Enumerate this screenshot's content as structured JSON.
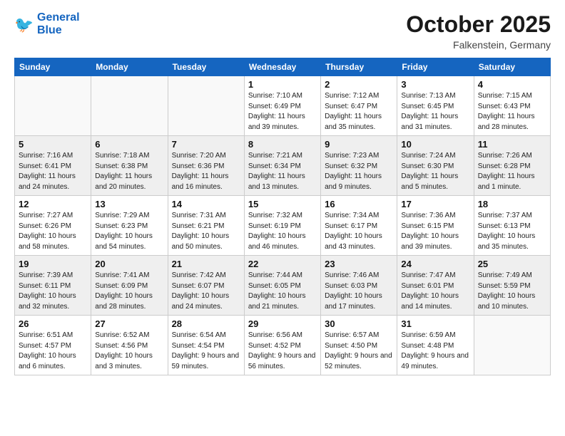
{
  "logo": {
    "line1": "General",
    "line2": "Blue"
  },
  "title": "October 2025",
  "location": "Falkenstein, Germany",
  "days_of_week": [
    "Sunday",
    "Monday",
    "Tuesday",
    "Wednesday",
    "Thursday",
    "Friday",
    "Saturday"
  ],
  "weeks": [
    [
      {
        "num": "",
        "sunrise": "",
        "sunset": "",
        "daylight": ""
      },
      {
        "num": "",
        "sunrise": "",
        "sunset": "",
        "daylight": ""
      },
      {
        "num": "",
        "sunrise": "",
        "sunset": "",
        "daylight": ""
      },
      {
        "num": "1",
        "sunrise": "Sunrise: 7:10 AM",
        "sunset": "Sunset: 6:49 PM",
        "daylight": "Daylight: 11 hours and 39 minutes."
      },
      {
        "num": "2",
        "sunrise": "Sunrise: 7:12 AM",
        "sunset": "Sunset: 6:47 PM",
        "daylight": "Daylight: 11 hours and 35 minutes."
      },
      {
        "num": "3",
        "sunrise": "Sunrise: 7:13 AM",
        "sunset": "Sunset: 6:45 PM",
        "daylight": "Daylight: 11 hours and 31 minutes."
      },
      {
        "num": "4",
        "sunrise": "Sunrise: 7:15 AM",
        "sunset": "Sunset: 6:43 PM",
        "daylight": "Daylight: 11 hours and 28 minutes."
      }
    ],
    [
      {
        "num": "5",
        "sunrise": "Sunrise: 7:16 AM",
        "sunset": "Sunset: 6:41 PM",
        "daylight": "Daylight: 11 hours and 24 minutes."
      },
      {
        "num": "6",
        "sunrise": "Sunrise: 7:18 AM",
        "sunset": "Sunset: 6:38 PM",
        "daylight": "Daylight: 11 hours and 20 minutes."
      },
      {
        "num": "7",
        "sunrise": "Sunrise: 7:20 AM",
        "sunset": "Sunset: 6:36 PM",
        "daylight": "Daylight: 11 hours and 16 minutes."
      },
      {
        "num": "8",
        "sunrise": "Sunrise: 7:21 AM",
        "sunset": "Sunset: 6:34 PM",
        "daylight": "Daylight: 11 hours and 13 minutes."
      },
      {
        "num": "9",
        "sunrise": "Sunrise: 7:23 AM",
        "sunset": "Sunset: 6:32 PM",
        "daylight": "Daylight: 11 hours and 9 minutes."
      },
      {
        "num": "10",
        "sunrise": "Sunrise: 7:24 AM",
        "sunset": "Sunset: 6:30 PM",
        "daylight": "Daylight: 11 hours and 5 minutes."
      },
      {
        "num": "11",
        "sunrise": "Sunrise: 7:26 AM",
        "sunset": "Sunset: 6:28 PM",
        "daylight": "Daylight: 11 hours and 1 minute."
      }
    ],
    [
      {
        "num": "12",
        "sunrise": "Sunrise: 7:27 AM",
        "sunset": "Sunset: 6:26 PM",
        "daylight": "Daylight: 10 hours and 58 minutes."
      },
      {
        "num": "13",
        "sunrise": "Sunrise: 7:29 AM",
        "sunset": "Sunset: 6:23 PM",
        "daylight": "Daylight: 10 hours and 54 minutes."
      },
      {
        "num": "14",
        "sunrise": "Sunrise: 7:31 AM",
        "sunset": "Sunset: 6:21 PM",
        "daylight": "Daylight: 10 hours and 50 minutes."
      },
      {
        "num": "15",
        "sunrise": "Sunrise: 7:32 AM",
        "sunset": "Sunset: 6:19 PM",
        "daylight": "Daylight: 10 hours and 46 minutes."
      },
      {
        "num": "16",
        "sunrise": "Sunrise: 7:34 AM",
        "sunset": "Sunset: 6:17 PM",
        "daylight": "Daylight: 10 hours and 43 minutes."
      },
      {
        "num": "17",
        "sunrise": "Sunrise: 7:36 AM",
        "sunset": "Sunset: 6:15 PM",
        "daylight": "Daylight: 10 hours and 39 minutes."
      },
      {
        "num": "18",
        "sunrise": "Sunrise: 7:37 AM",
        "sunset": "Sunset: 6:13 PM",
        "daylight": "Daylight: 10 hours and 35 minutes."
      }
    ],
    [
      {
        "num": "19",
        "sunrise": "Sunrise: 7:39 AM",
        "sunset": "Sunset: 6:11 PM",
        "daylight": "Daylight: 10 hours and 32 minutes."
      },
      {
        "num": "20",
        "sunrise": "Sunrise: 7:41 AM",
        "sunset": "Sunset: 6:09 PM",
        "daylight": "Daylight: 10 hours and 28 minutes."
      },
      {
        "num": "21",
        "sunrise": "Sunrise: 7:42 AM",
        "sunset": "Sunset: 6:07 PM",
        "daylight": "Daylight: 10 hours and 24 minutes."
      },
      {
        "num": "22",
        "sunrise": "Sunrise: 7:44 AM",
        "sunset": "Sunset: 6:05 PM",
        "daylight": "Daylight: 10 hours and 21 minutes."
      },
      {
        "num": "23",
        "sunrise": "Sunrise: 7:46 AM",
        "sunset": "Sunset: 6:03 PM",
        "daylight": "Daylight: 10 hours and 17 minutes."
      },
      {
        "num": "24",
        "sunrise": "Sunrise: 7:47 AM",
        "sunset": "Sunset: 6:01 PM",
        "daylight": "Daylight: 10 hours and 14 minutes."
      },
      {
        "num": "25",
        "sunrise": "Sunrise: 7:49 AM",
        "sunset": "Sunset: 5:59 PM",
        "daylight": "Daylight: 10 hours and 10 minutes."
      }
    ],
    [
      {
        "num": "26",
        "sunrise": "Sunrise: 6:51 AM",
        "sunset": "Sunset: 4:57 PM",
        "daylight": "Daylight: 10 hours and 6 minutes."
      },
      {
        "num": "27",
        "sunrise": "Sunrise: 6:52 AM",
        "sunset": "Sunset: 4:56 PM",
        "daylight": "Daylight: 10 hours and 3 minutes."
      },
      {
        "num": "28",
        "sunrise": "Sunrise: 6:54 AM",
        "sunset": "Sunset: 4:54 PM",
        "daylight": "Daylight: 9 hours and 59 minutes."
      },
      {
        "num": "29",
        "sunrise": "Sunrise: 6:56 AM",
        "sunset": "Sunset: 4:52 PM",
        "daylight": "Daylight: 9 hours and 56 minutes."
      },
      {
        "num": "30",
        "sunrise": "Sunrise: 6:57 AM",
        "sunset": "Sunset: 4:50 PM",
        "daylight": "Daylight: 9 hours and 52 minutes."
      },
      {
        "num": "31",
        "sunrise": "Sunrise: 6:59 AM",
        "sunset": "Sunset: 4:48 PM",
        "daylight": "Daylight: 9 hours and 49 minutes."
      },
      {
        "num": "",
        "sunrise": "",
        "sunset": "",
        "daylight": ""
      }
    ]
  ]
}
